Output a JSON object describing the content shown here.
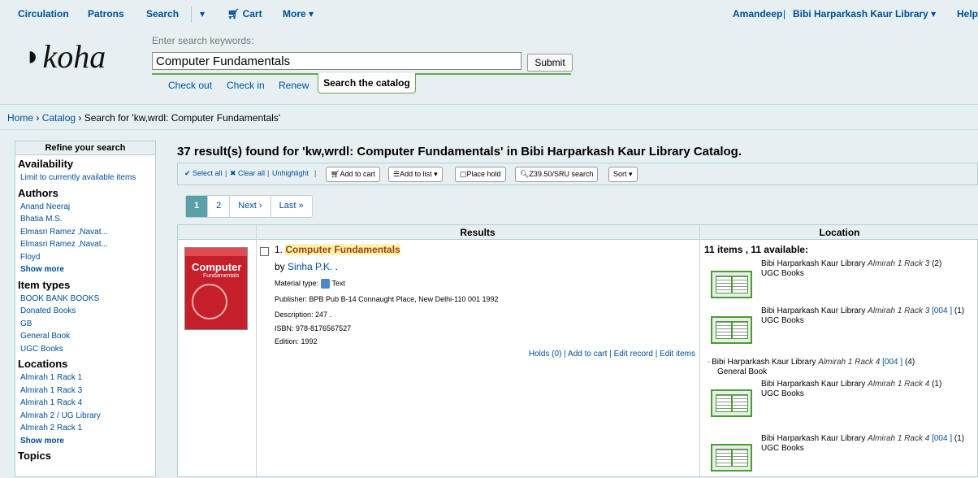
{
  "nav": {
    "circulation": "Circulation",
    "patrons": "Patrons",
    "search": "Search",
    "cart": "Cart",
    "more": "More",
    "user": "Amandeep",
    "separator": "|",
    "library": "Bibi Harparkash Kaur Library",
    "help": "Help"
  },
  "logo": {
    "text": "koha"
  },
  "search": {
    "label": "Enter search keywords:",
    "value": "Computer Fundamentals",
    "submit": "Submit"
  },
  "subtabs": {
    "checkout": "Check out",
    "checkin": "Check in",
    "renew": "Renew",
    "catalog": "Search the catalog"
  },
  "breadcrumb": {
    "home": "Home",
    "catalog": "Catalog",
    "current": "Search for 'kw,wrdl: Computer Fundamentals'"
  },
  "sidebar": {
    "heading": "Refine your search",
    "availability": {
      "title": "Availability",
      "items": [
        "Limit to currently available items"
      ]
    },
    "authors": {
      "title": "Authors",
      "items": [
        "Anand Neeraj",
        "Bhatia M.S.",
        "Elmasri Ramez ,Navat...",
        "Elmasri Ramez ,Navat...",
        "Floyd"
      ],
      "more": "Show more"
    },
    "item_types": {
      "title": "Item types",
      "items": [
        "BOOK BANK BOOKS",
        "Donated Books",
        "GB",
        "General Book",
        "UGC Books"
      ]
    },
    "locations": {
      "title": "Locations",
      "items": [
        "Almirah 1 Rack 1",
        "Almirah 1 Rack 3",
        "Almirah 1 Rack 4",
        "Almirah 2 / UG Library",
        "Almirah 2 Rack 1"
      ],
      "more": "Show more"
    },
    "topics": {
      "title": "Topics"
    }
  },
  "results": {
    "heading": "37 result(s) found for 'kw,wrdl: Computer Fundamentals' in Bibi Harparkash Kaur Library Catalog.",
    "toolbar": {
      "select_all": "Select all",
      "clear_all": "Clear all",
      "unhighlight": "Unhighlight",
      "add_to_cart": "Add to cart",
      "add_to_list": "Add to list",
      "place_hold": "Place hold",
      "z3950": "Z39.50/SRU search",
      "sort": "Sort"
    },
    "pagination": {
      "page1": "1",
      "page2": "2",
      "next": "Next ›",
      "last": "Last »"
    },
    "columns": {
      "results": "Results",
      "location": "Location"
    },
    "record": {
      "number": "1.",
      "title": "Computer Fundamentals",
      "by_prefix": "by",
      "author": "Sinha P.K.",
      "author_suffix": ".",
      "material_label": "Material type:",
      "material_value": "Text",
      "publisher_label": "Publisher:",
      "publisher_value": "BPB Pub B-14 Connaught Place, New Delhi-110 001  1992",
      "description_label": "Description:",
      "description_value": "247 .",
      "isbn_label": "ISBN:",
      "isbn_value": "978-8176567527",
      "edition_label": "Edition:",
      "edition_value": "1992",
      "cover_title": "Computer",
      "cover_sub": "Fundamentals",
      "actions": {
        "holds": "Holds (0)",
        "add_to_cart": "Add to cart",
        "edit_record": "Edit record",
        "edit_items": "Edit items",
        "sep": "|"
      }
    },
    "location": {
      "summary": "11 items , 11 available:",
      "holdings": [
        {
          "library": "Bibi Harparkash Kaur Library",
          "shelf": "Almirah 1 Rack 3",
          "call": "",
          "count": "(2)",
          "type": "UGC Books"
        },
        {
          "library": "Bibi Harparkash Kaur Library",
          "shelf": "Almirah 1 Rack 3",
          "call": "[004 ]",
          "count": "(1)",
          "type": "UGC Books"
        },
        {
          "library": "Bibi Harparkash Kaur Library",
          "shelf": "Almirah 1 Rack 4",
          "call": "[004 ]",
          "count": "(4)",
          "type": "General Book"
        },
        {
          "library": "Bibi Harparkash Kaur Library",
          "shelf": "Almirah 1 Rack 4",
          "call": "",
          "count": "(1)",
          "type": "UGC Books"
        },
        {
          "library": "Bibi Harparkash Kaur Library",
          "shelf": "Almirah 1 Rack 4",
          "call": "[004 ]",
          "count": "(1)",
          "type": "UGC Books"
        }
      ]
    }
  },
  "colors": {
    "link": "#004d99",
    "accent_green": "#6aa84f",
    "background": "#e6f0f2",
    "title_highlight": "#fff3b0",
    "active_page": "#5aa0a8"
  }
}
